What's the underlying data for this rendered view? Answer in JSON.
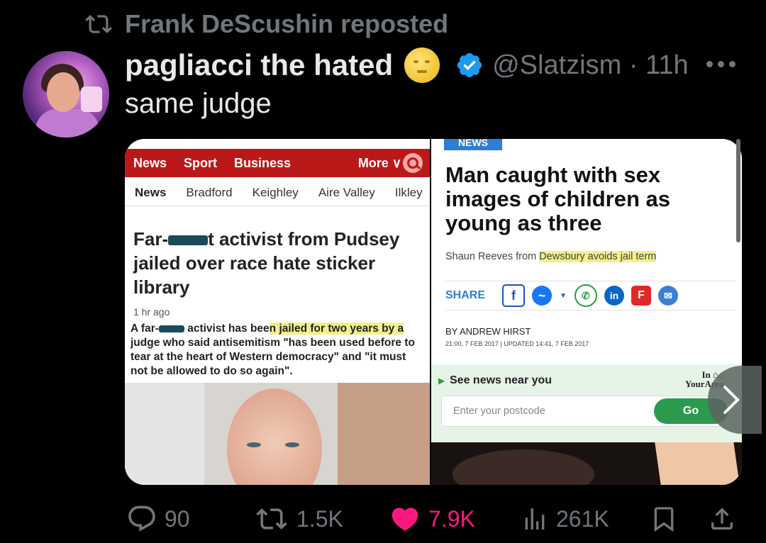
{
  "repost": {
    "text": "Frank DeScushin reposted"
  },
  "tweet": {
    "display_name": "pagliacci the hated",
    "handle": "@Slatzism",
    "time": "· 11h",
    "text": "same judge"
  },
  "left_article": {
    "topnav": [
      "News",
      "Sport",
      "Business"
    ],
    "more": "More ∨",
    "subnav": [
      "News",
      "Bradford",
      "Keighley",
      "Aire Valley",
      "Ilkley"
    ],
    "headline_part1": "Far-",
    "headline_part2": "t activist from Pudsey jailed over race hate sticker library",
    "time": "1 hr ago",
    "body_part1": "A far-",
    "body_part2": " activist has bee",
    "body_hl": "n jailed for two years by a",
    "body_part3": " judge who said antisemitism \"has been used before to tear at the heart of Western democracy\" and \"it must not be allowed to do so again\"."
  },
  "right_article": {
    "tag": "NEWS",
    "headline": "Man caught with sex images of children as young as three",
    "sub_part1": "Shaun Reeves from ",
    "sub_hl": "Dewsbury avoids jail term",
    "share_label": "SHARE",
    "byline": "BY ANDREW HIRST",
    "dates": "21:00, 7 FEB 2017   |   UPDATED 14:41, 7 FEB 2017",
    "near_label": "See news near you",
    "logo_top": "In ⌂⌂",
    "logo_bottom": "YourArea",
    "postcode_placeholder": "Enter your postcode",
    "go_label": "Go"
  },
  "actions": {
    "replies": "90",
    "reposts": "1.5K",
    "likes": "7.9K",
    "views": "261K"
  },
  "colors": {
    "like": "#f91880",
    "verified": "#1d9bf0",
    "bbc_red": "#bb1919"
  }
}
